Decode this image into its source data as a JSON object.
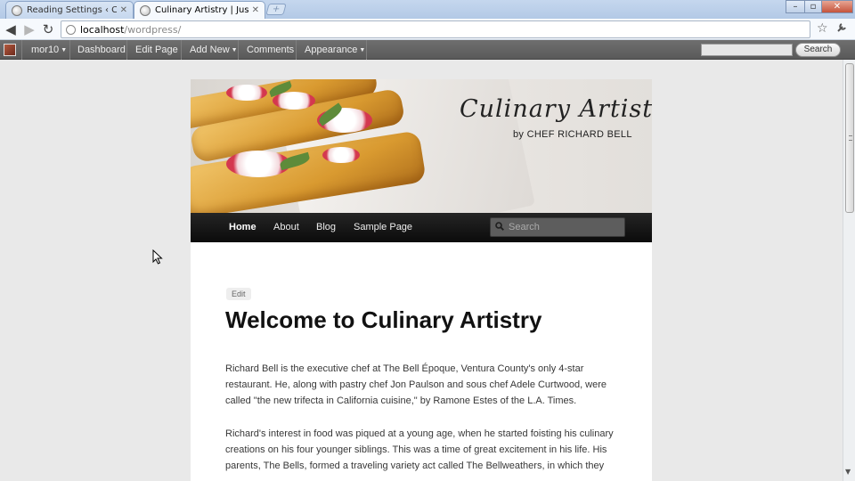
{
  "browser": {
    "tabs": [
      {
        "title": "Reading Settings ‹ Culinary",
        "active": false
      },
      {
        "title": "Culinary Artistry | Just anoth",
        "active": true
      }
    ],
    "new_tab_symbol": "+",
    "window_controls": {
      "minimize": "–",
      "restore": "▫",
      "close": "✕"
    },
    "url_host": "localhost",
    "url_path": "/wordpress/",
    "nav_icons": {
      "back": "◀",
      "forward": "▶",
      "reload": "↻",
      "star": "☆",
      "wrench": "🔧"
    }
  },
  "admin_bar": {
    "user": "mor10",
    "items": [
      "Dashboard",
      "Edit Page",
      "Add New",
      "Comments",
      "Appearance"
    ],
    "search_button": "Search"
  },
  "site": {
    "logo_title": "Culinary Artistry",
    "logo_byline": "by CHEF RICHARD BELL",
    "menu": [
      "Home",
      "About",
      "Blog",
      "Sample Page"
    ],
    "search_placeholder": "Search"
  },
  "post": {
    "edit_label": "Edit",
    "title": "Welcome to Culinary Artistry",
    "paragraphs": [
      "Richard Bell is the executive chef at The Bell Époque, Ventura County's only 4-star restaurant. He, along with pastry chef Jon Paulson and sous chef Adele Curtwood, were called \"the new trifecta in California cuisine,\" by Ramone Estes of the L.A. Times.",
      "Richard's interest in food was piqued at a young age, when he started foisting his culinary creations on his four younger siblings. This was a time of great excitement in his life. His parents, The Bells, formed a traveling variety act called The Bellweathers, in which they"
    ]
  },
  "colors": {
    "admin_bar": "#5f5f5f",
    "site_nav": "#1a1a1a",
    "page_bg": "#e9e9e9"
  }
}
